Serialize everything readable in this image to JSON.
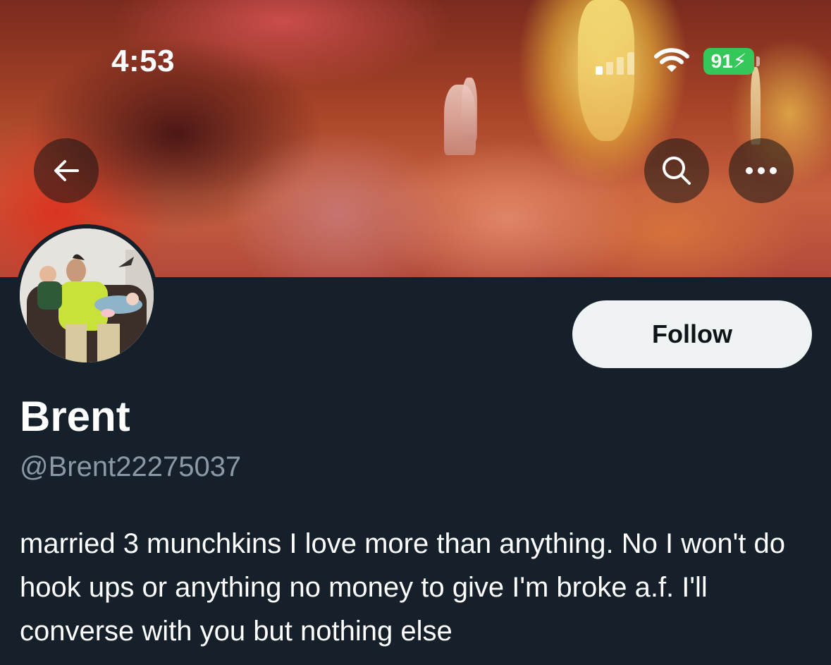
{
  "status_bar": {
    "time": "4:53",
    "battery_percent": "91",
    "battery_charging": true,
    "signal_bars_active": 1,
    "signal_bars_total": 4,
    "battery_color": "#35c759"
  },
  "header": {
    "back_icon": "arrow-left-icon",
    "search_icon": "search-icon",
    "more_icon": "more-horizontal-icon"
  },
  "profile": {
    "display_name": "Brent",
    "handle": "@Brent22275037",
    "follow_label": "Follow",
    "bio": "married 3 munchkins I love more than anything. No I won't do hook ups or anything no money to give I'm broke a.f. I'll converse with you but nothing else"
  },
  "colors": {
    "background": "#15202b",
    "secondary_text": "#8b98a5",
    "follow_button_bg": "#eff3f4",
    "follow_button_text": "#0f1419"
  }
}
